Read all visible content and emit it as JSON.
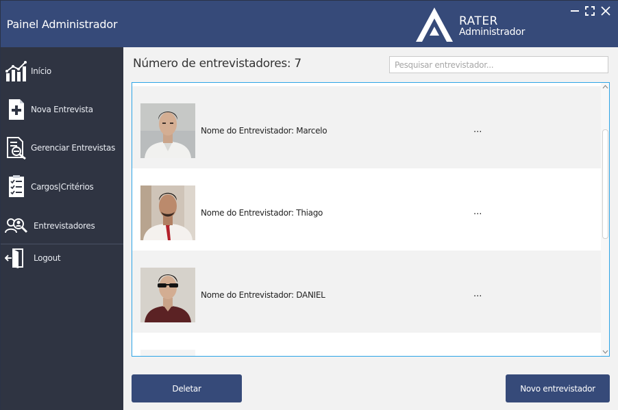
{
  "sidebar": {
    "title": "Painel Administrador",
    "items": [
      {
        "label": "Início",
        "icon": "chart-icon"
      },
      {
        "label": "Nova Entrevista",
        "icon": "add-document-icon"
      },
      {
        "label": "Gerenciar Entrevistas",
        "icon": "search-document-icon"
      },
      {
        "label": "Cargos|Critérios",
        "icon": "checklist-icon"
      },
      {
        "label": "Entrevistadores",
        "icon": "users-search-icon"
      },
      {
        "label": "Logout",
        "icon": "logout-door-icon"
      }
    ]
  },
  "header": {
    "brand": "RATER",
    "subtitle": "Administrador",
    "controls": [
      "minimize-icon",
      "maximize-icon",
      "close-icon"
    ]
  },
  "main": {
    "count_label": "Número de entrevistadores: 7",
    "search_placeholder": "Pesquisar entrevistador...",
    "rows": [
      {
        "name": "Nome do Entrevistador: Marcelo",
        "more": "..."
      },
      {
        "name": "Nome do Entrevistador: Thiago",
        "more": "..."
      },
      {
        "name": "Nome do Entrevistador: DANIEL",
        "more": "..."
      }
    ],
    "delete_label": "Deletar",
    "new_label": "Novo entrevistador"
  },
  "colors": {
    "header_blue": "#364a79",
    "sidebar_dark": "#2f3442",
    "list_border": "#2aa3e6"
  }
}
